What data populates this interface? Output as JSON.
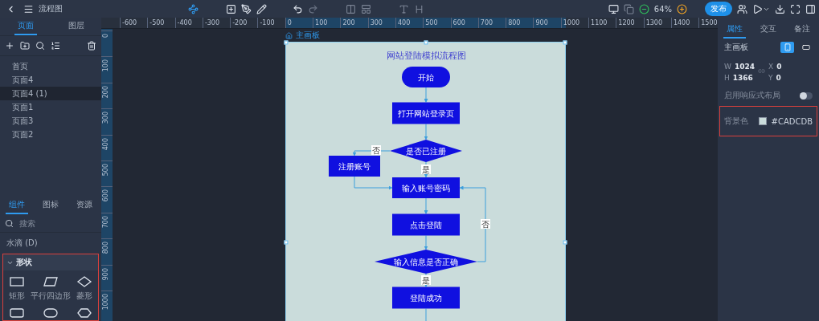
{
  "top_bar": {
    "title": "流程图",
    "zoom": "64%",
    "publish": "发布"
  },
  "pages_panel": {
    "tabs": [
      {
        "label": "页面",
        "selected": true
      },
      {
        "label": "图层",
        "selected": false
      }
    ],
    "pages": [
      {
        "label": "首页",
        "selected": false
      },
      {
        "label": "页面4",
        "selected": false
      },
      {
        "label": "页面4 (1)",
        "selected": true
      },
      {
        "label": "页面1",
        "selected": false
      },
      {
        "label": "页面3",
        "selected": false
      },
      {
        "label": "页面2",
        "selected": false
      }
    ]
  },
  "components_panel": {
    "tabs": [
      {
        "label": "组件",
        "selected": true
      },
      {
        "label": "图标",
        "selected": false
      },
      {
        "label": "资源",
        "selected": false
      }
    ],
    "search": {
      "placeholder": "搜索"
    },
    "library": "水滴 (D)",
    "group": {
      "title": "形状",
      "expanded": true,
      "shapes": [
        {
          "kind": "rectangle",
          "label": "矩形"
        },
        {
          "kind": "parallelogram",
          "label": "平行四边形"
        },
        {
          "kind": "diamond",
          "label": "菱形"
        },
        {
          "kind": "rounded"
        },
        {
          "kind": "stadium"
        },
        {
          "kind": "hexagon"
        }
      ]
    }
  },
  "rulers": {
    "horizontal": [
      "-600",
      "-500",
      "-400",
      "-300",
      "-200",
      "-100",
      "0",
      "100",
      "200",
      "300",
      "400",
      "500",
      "600",
      "700",
      "800",
      "900",
      "1000",
      "1100",
      "1200",
      "1300",
      "1400",
      "1500"
    ],
    "vertical": [
      "0",
      "100",
      "200",
      "300",
      "400",
      "500",
      "600",
      "700",
      "800",
      "900",
      "1000"
    ]
  },
  "artboard": {
    "label": "主画板",
    "title": "网站登陆模拟流程图",
    "nodes": [
      {
        "kind": "terminal",
        "label": "开始"
      },
      {
        "kind": "process",
        "label": "打开网站登录页"
      },
      {
        "kind": "decision",
        "label": "是否已注册"
      },
      {
        "kind": "process",
        "label": "注册账号"
      },
      {
        "kind": "process",
        "label": "输入账号密码"
      },
      {
        "kind": "process",
        "label": "点击登陆"
      },
      {
        "kind": "decision",
        "label": "输入信息是否正确"
      },
      {
        "kind": "process",
        "label": "登陆成功"
      }
    ],
    "edge_labels": [
      "否",
      "是",
      "否",
      "是"
    ]
  },
  "properties_panel": {
    "tabs": [
      {
        "label": "属性",
        "selected": true
      },
      {
        "label": "交互",
        "selected": false
      },
      {
        "label": "备注",
        "selected": false
      }
    ],
    "artboard_label": "主画板",
    "orientation": [
      {
        "kind": "portrait",
        "selected": true
      },
      {
        "kind": "landscape",
        "selected": false
      }
    ],
    "fields": [
      {
        "label": "W",
        "value": "1024"
      },
      {
        "label": "X",
        "value": "0"
      },
      {
        "label": "H",
        "value": "1366"
      },
      {
        "label": "Y",
        "value": "0"
      }
    ],
    "responsive": {
      "label": "启用响应式布局",
      "on": false
    },
    "background": {
      "label": "背景色",
      "value": "#CADCDB"
    }
  }
}
